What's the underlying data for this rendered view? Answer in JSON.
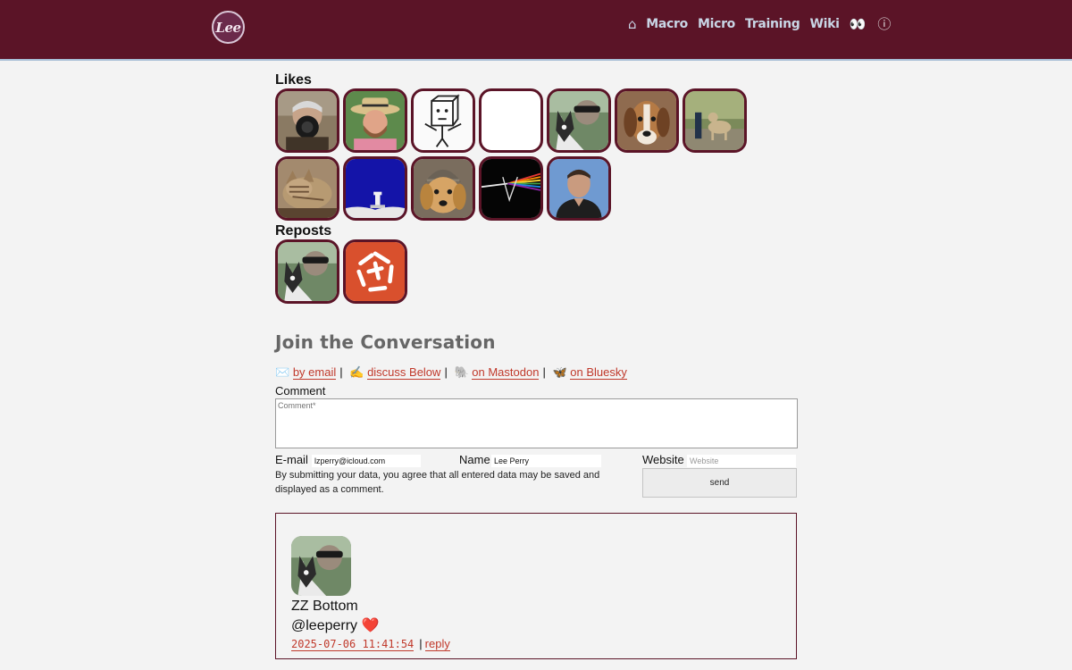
{
  "header": {
    "logo_text": "Lee",
    "nav": {
      "home_glyph": "⌂",
      "macro": "Macro",
      "micro": "Micro",
      "training": "Training",
      "wiki": "Wiki",
      "eyes_glyph": "👀",
      "info_glyph": "ⓘ"
    }
  },
  "likes": {
    "title": "Likes",
    "avatars": [
      "person-with-camera",
      "man-with-straw-hat",
      "cartoon-box-character",
      "blank",
      "person-with-dog-selfie",
      "beagle-dog",
      "dog-on-trail",
      "tabby-cat",
      "blue-pixel-scene",
      "dog-with-knit-hat",
      "prism-album-art",
      "man-portrait"
    ]
  },
  "reposts": {
    "title": "Reposts",
    "avatars": [
      "person-with-dog-selfie",
      "red-spiral-logo"
    ]
  },
  "join": {
    "title": "Join the Conversation",
    "links": {
      "email_emoji": "✉️",
      "email": "by email",
      "below_emoji": "✍️",
      "below": "discuss Below",
      "mastodon_emoji": "🐘",
      "mastodon": "on Mastodon",
      "bluesky_emoji": "🦋",
      "bluesky": "on Bluesky",
      "separator": "|"
    },
    "comment_label": "Comment",
    "comment_placeholder": "Comment*",
    "email_label": "E-mail",
    "email_value": "lzperry@icloud.com",
    "name_label": "Name",
    "name_value": "Lee Perry",
    "website_label": "Website",
    "website_placeholder": "Website",
    "consent": "By submitting your data, you agree that all entered data may be saved and displayed as a comment.",
    "send": "send"
  },
  "comment": {
    "name": "ZZ Bottom",
    "handle": "@leeperry",
    "heart": "❤️",
    "date": "2025-07-06 11:41:54",
    "pipe": "|",
    "reply": "reply"
  },
  "colors": {
    "header_bg": "#5b1427",
    "link": "#c0392b",
    "avatar_border": "#5b1427"
  }
}
